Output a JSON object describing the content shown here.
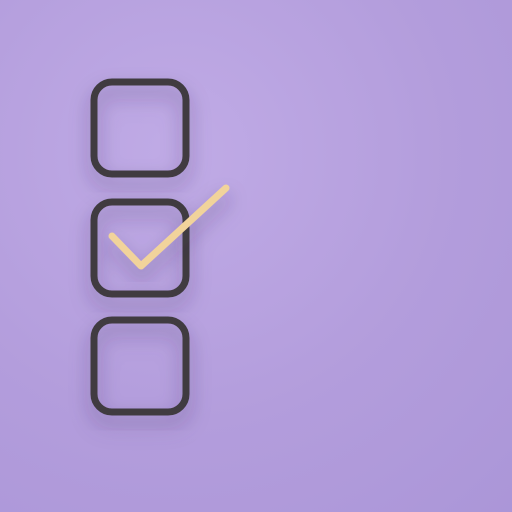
{
  "colors": {
    "background": "#b39ddc",
    "stroke": "#3f3a41",
    "check": "#f1d39b"
  },
  "icon": {
    "name": "checklist-icon",
    "items": [
      {
        "checked": false
      },
      {
        "checked": true
      },
      {
        "checked": false
      }
    ]
  }
}
